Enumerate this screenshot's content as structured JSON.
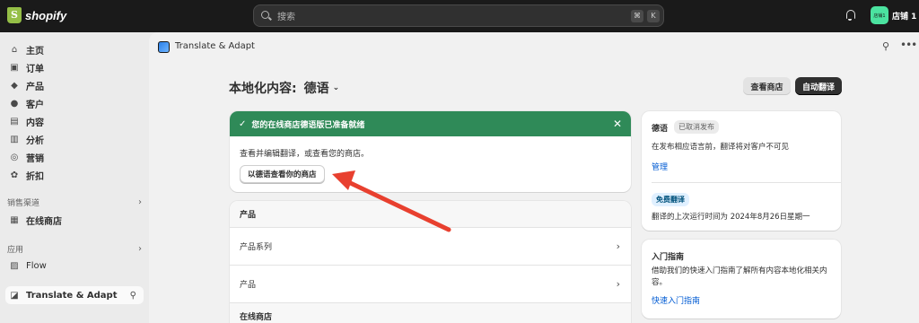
{
  "topbar": {
    "logo_text": "shopify",
    "search_placeholder": "搜索",
    "shortcut_keys": [
      "⌘",
      "K"
    ],
    "store_avatar_text": "店铺1",
    "store_name": "店铺 1"
  },
  "sidebar": {
    "items": [
      {
        "label": "主页",
        "icon": "home-icon"
      },
      {
        "label": "订单",
        "icon": "inbox-icon"
      },
      {
        "label": "产品",
        "icon": "tag-icon"
      },
      {
        "label": "客户",
        "icon": "person-icon"
      },
      {
        "label": "内容",
        "icon": "image-icon"
      },
      {
        "label": "分析",
        "icon": "bar-chart-icon"
      },
      {
        "label": "营销",
        "icon": "target-icon"
      },
      {
        "label": "折扣",
        "icon": "discount-icon"
      }
    ],
    "sales_channels_label": "销售渠道",
    "online_store_label": "在线商店",
    "apps_label": "应用",
    "flow_label": "Flow",
    "active_app_label": "Translate & Adapt"
  },
  "app_header": {
    "title": "Translate & Adapt"
  },
  "page": {
    "title": "本地化内容:",
    "language": "德语",
    "view_store_button": "查看商店",
    "auto_translate_button": "自动翻译"
  },
  "banner": {
    "message": "您的在线商店德语版已准备就绪",
    "body": "查看并编辑翻译，或查看您的商店。",
    "view_button": "以德语查看你的商店"
  },
  "list": {
    "header_products": "产品",
    "rows": [
      "产品系列",
      "产品"
    ],
    "header_online_store": "在线商店"
  },
  "status_card": {
    "language": "德语",
    "status_badge": "已取消发布",
    "description": "在发布相应语言前，翻译将对客户不可见",
    "manage_link": "管理",
    "free_badge": "免费翻译",
    "last_run": "翻译的上次运行时间为 2024年8月26日星期一"
  },
  "guide_card": {
    "title": "入门指南",
    "body": "借助我们的快速入门指南了解所有内容本地化相关内容。",
    "link": "快速入门指南"
  },
  "colors": {
    "accent_green": "#2f8a58",
    "annotation_red": "#e8402f",
    "link_blue": "#005bd3"
  }
}
